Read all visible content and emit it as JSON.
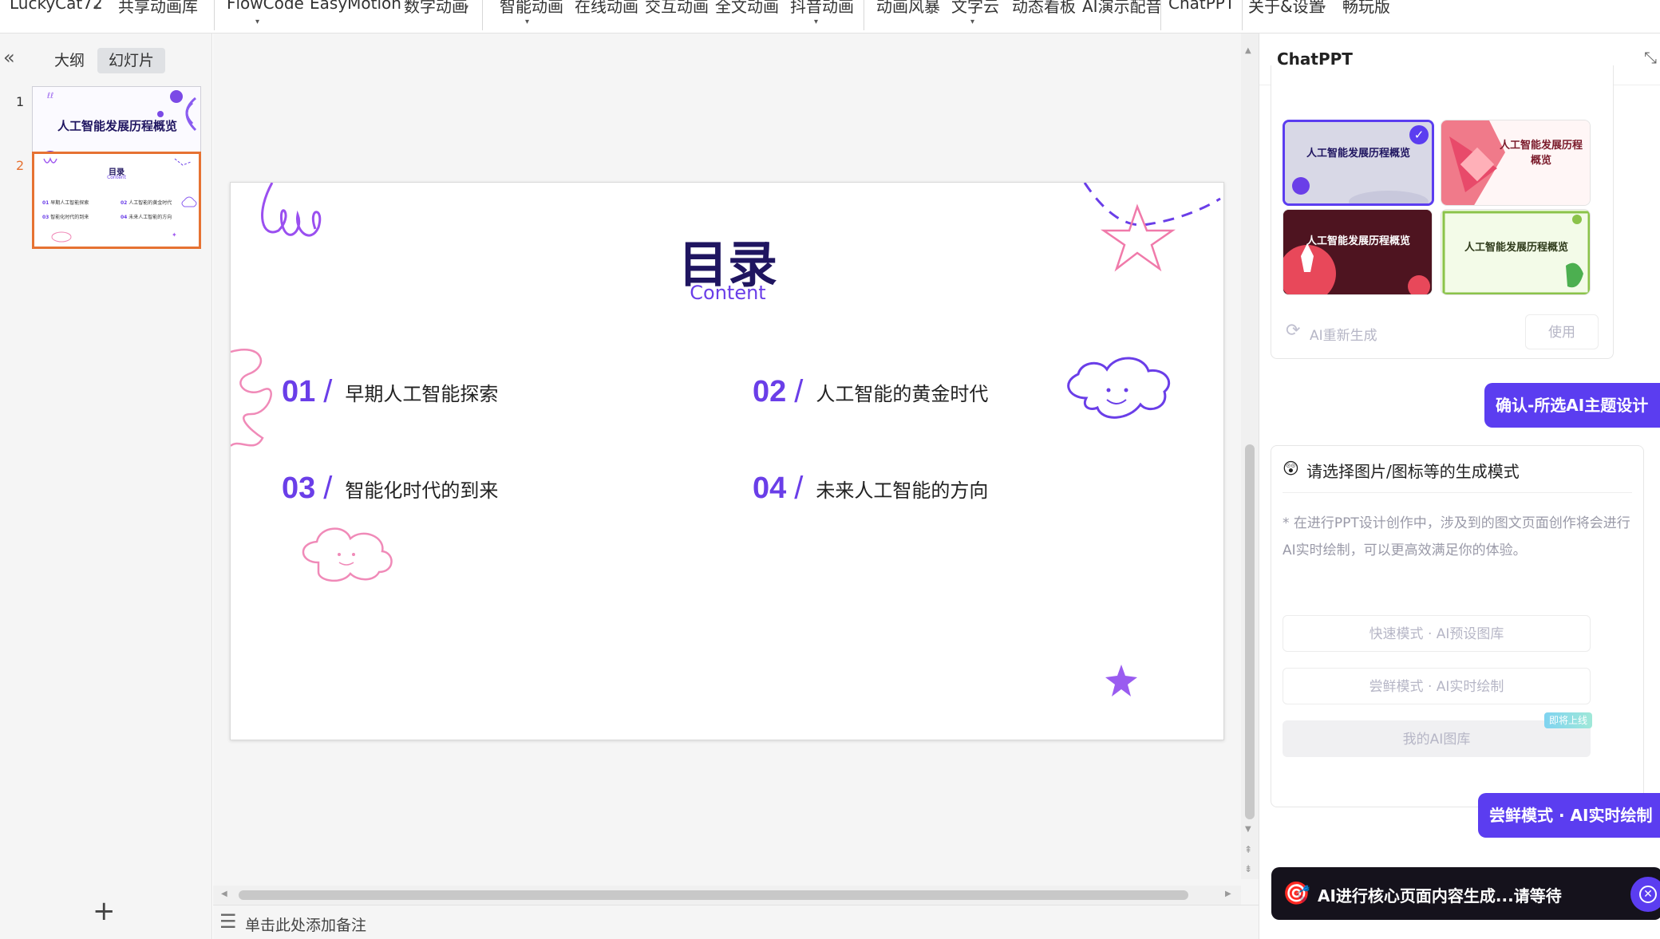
{
  "toolbar": {
    "items": [
      "LuckyCat72",
      "共享动画库",
      "FlowCode",
      "EasyMotion",
      "数字动画",
      "智能动画",
      "在线动画",
      "交互动画",
      "全文动画",
      "抖音动画",
      "动画风暴",
      "文字云",
      "动态看板",
      "AI演示配音",
      "ChatPPT",
      "关于&设置",
      "畅玩版"
    ]
  },
  "left_panel": {
    "collapse_icon": "«",
    "tabs": [
      "大纲",
      "幻灯片"
    ],
    "active_tab": "幻灯片",
    "slides": [
      {
        "num": "1",
        "title": "人工智能发展历程概览"
      },
      {
        "num": "2",
        "title": "目录",
        "subtitle": "Content"
      }
    ],
    "add_icon": "+",
    "thumb2_items": [
      "01",
      "早期人工智能探索",
      "02",
      "人工智能的黄金时代",
      "03",
      "智能化时代的到来",
      "04",
      "未来人工智能的方向"
    ]
  },
  "slide": {
    "title": "目录",
    "subtitle": "Content",
    "items": [
      {
        "num": "01",
        "text": "早期人工智能探索"
      },
      {
        "num": "02",
        "text": "人工智能的黄金时代"
      },
      {
        "num": "03",
        "text": "智能化时代的到来"
      },
      {
        "num": "04",
        "text": "未来人工智能的方向"
      }
    ]
  },
  "notes": {
    "placeholder": "单击此处添加备注"
  },
  "right_panel": {
    "title": "ChatPPT",
    "themes": [
      {
        "title": "人工智能发展历程概览",
        "selected": true
      },
      {
        "title": "人工智能发展历程概览",
        "selected": false
      },
      {
        "title": "人工智能发展历程概览",
        "selected": false
      },
      {
        "title": "人工智能发展历程概览",
        "selected": false
      }
    ],
    "regen_label": "AI重新生成",
    "use_label": "使用",
    "confirm_chip": "确认-所选AI主题设计",
    "mode_card": {
      "emoji": "😲",
      "title": "请选择图片/图标等的生成模式",
      "desc": "* 在进行PPT设计创作中，涉及到的图文页面创作将会进行AI实时绘制，可以更高效满足你的体验。",
      "buttons": [
        "快速模式 · AI预设图库",
        "尝鲜模式 · AI实时绘制",
        "我的AI图库"
      ],
      "badge": "即将上线"
    },
    "mode_chip": "尝鲜模式 · AI实时绘制",
    "progress_text": "AI进行核心页面内容生成...请等待"
  },
  "colors": {
    "accent": "#5b3df0",
    "slide_purple": "#6a3ee8",
    "title_navy": "#1f1560",
    "selection_orange": "#e67232",
    "pink": "#f08ab8"
  }
}
